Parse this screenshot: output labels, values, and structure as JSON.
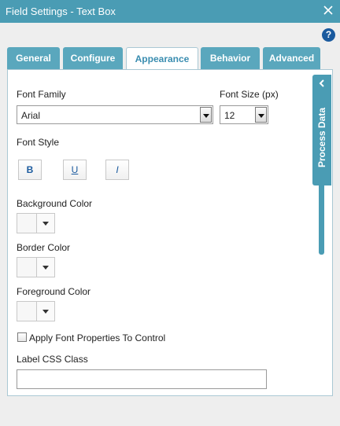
{
  "window": {
    "title": "Field Settings - Text Box"
  },
  "help": {
    "label": "?"
  },
  "tabs": [
    {
      "label": "General"
    },
    {
      "label": "Configure"
    },
    {
      "label": "Appearance"
    },
    {
      "label": "Behavior"
    },
    {
      "label": "Advanced"
    }
  ],
  "active_tab": "Appearance",
  "form": {
    "font_family": {
      "label": "Font Family",
      "value": "Arial"
    },
    "font_size": {
      "label": "Font Size (px)",
      "value": "12"
    },
    "font_style": {
      "label": "Font Style",
      "bold": "B",
      "underline": "U",
      "italic": "I"
    },
    "background_color": {
      "label": "Background Color"
    },
    "border_color": {
      "label": "Border Color"
    },
    "foreground_color": {
      "label": "Foreground Color"
    },
    "apply_font": {
      "label": "Apply Font Properties To Control"
    },
    "label_css": {
      "label": "Label CSS Class",
      "value": ""
    }
  },
  "side_panel": {
    "label": "Process Data"
  },
  "colors": {
    "accent": "#4a9cb4",
    "active_tab_text": "#3a8db0",
    "help_icon": "#1a5a9e"
  }
}
